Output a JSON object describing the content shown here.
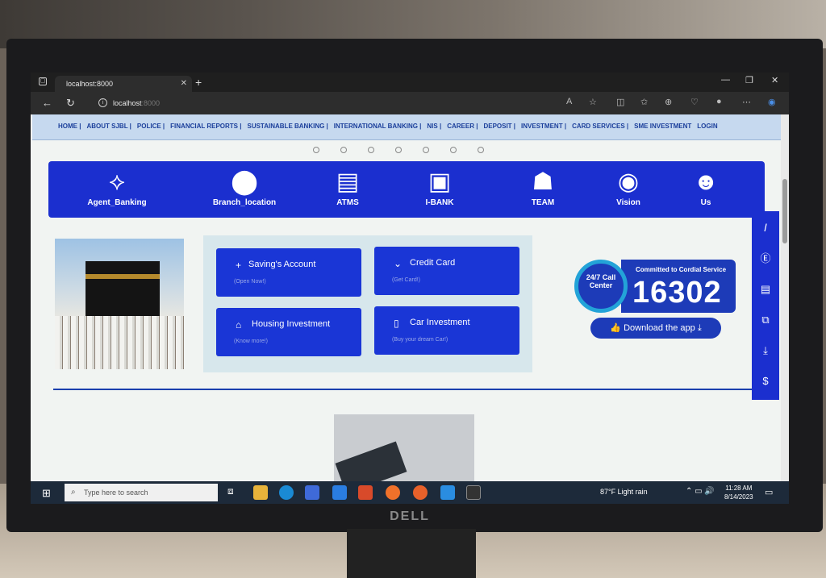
{
  "browser": {
    "tab_title": "localhost:8000",
    "url_host": "localhost",
    "url_port": ":8000"
  },
  "nav": {
    "items": [
      "HOME |",
      "ABOUT SJBL |",
      "POLICE |",
      "FINANCIAL REPORTS |",
      "SUSTAINABLE BANKING |",
      "INTERNATIONAL BANKING |",
      "NIS |",
      "CAREER |",
      "DEPOSIT |",
      "INVESTMENT |",
      "CARD SERVICES |",
      "SME INVESTMENT",
      "LOGIN"
    ]
  },
  "iconbar": {
    "items": [
      {
        "label": "Agent_Banking",
        "icon": "agent-banking-logo"
      },
      {
        "label": "Branch_location",
        "icon": "map-pin-icon"
      },
      {
        "label": "ATMS",
        "icon": "atm-icon"
      },
      {
        "label": "I-BANK",
        "icon": "bank-icon"
      },
      {
        "label": "TEAM",
        "icon": "team-icon"
      },
      {
        "label": "Vision",
        "icon": "eye-icon"
      },
      {
        "label": "Us",
        "icon": "user-icon"
      }
    ]
  },
  "services": [
    {
      "title": "Saving's Account",
      "sub": "(Open Now!)",
      "icon": "plus-icon"
    },
    {
      "title": "Credit Card",
      "sub": "(Get Card!)",
      "icon": "chevron-down-icon"
    },
    {
      "title": "Housing Investment",
      "sub": "(Know more!)",
      "icon": "home-icon"
    },
    {
      "title": "Car Investment",
      "sub": "(Buy your dream Car!)",
      "icon": "document-icon"
    }
  ],
  "callcenter": {
    "ring_text": "24/7 Call Center",
    "caption": "Committed to Cordial Service",
    "number": "16302"
  },
  "download": {
    "label": "Download the app"
  },
  "taskbar": {
    "search_placeholder": "Type here to search",
    "weather": "87°F  Light rain",
    "time": "11:28 AM",
    "date": "8/14/2023"
  },
  "colors": {
    "primary_blue": "#1b2fcf",
    "nav_bg": "#c6d9ef",
    "nav_text": "#1b3f9b"
  }
}
